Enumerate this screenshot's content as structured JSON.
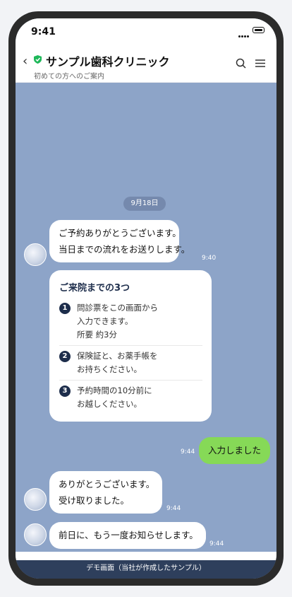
{
  "status_bar": {
    "time": "9:41"
  },
  "header": {
    "back_icon": "chevron-left-icon",
    "title": "サンプル歯科クリニック",
    "subtitle": "初めての方へのご案内",
    "verified_icon": "shield-check-icon",
    "search_icon": "search-icon",
    "menu_icon": "menu-icon"
  },
  "chat": {
    "date": "9月18日",
    "messages": [
      {
        "lines": [
          "ご予約ありがとうございます。",
          "当日までの流れをお送りします。"
        ],
        "time": "9:40"
      },
      {
        "lines": [
          "入力しました"
        ],
        "time": "9:44"
      },
      {
        "lines": [
          "ありがとうございます。",
          "受け取りました。"
        ],
        "time": "9:44"
      },
      {
        "lines": [
          "前日に、もう一度お知らせします。"
        ],
        "time": "9:44"
      }
    ],
    "card": {
      "title": "ご来院までの3つ",
      "steps": [
        {
          "num": "1",
          "lines": [
            "問診票をこの画面から",
            "入力できます。",
            "所要 約3分"
          ]
        },
        {
          "num": "2",
          "lines": [
            "保険証と、お薬手帳を",
            "お持ちください。"
          ]
        },
        {
          "num": "3",
          "lines": [
            "予約時間の10分前に",
            "お越しください。"
          ]
        }
      ]
    }
  },
  "footer": {
    "label": "デモ画面（当社が作成したサンプル）"
  },
  "colors": {
    "chat_bg": "#8da4c8",
    "user_bubble": "#86d957",
    "navy": "#1d2d4b",
    "verified_green": "#1fb85a"
  }
}
